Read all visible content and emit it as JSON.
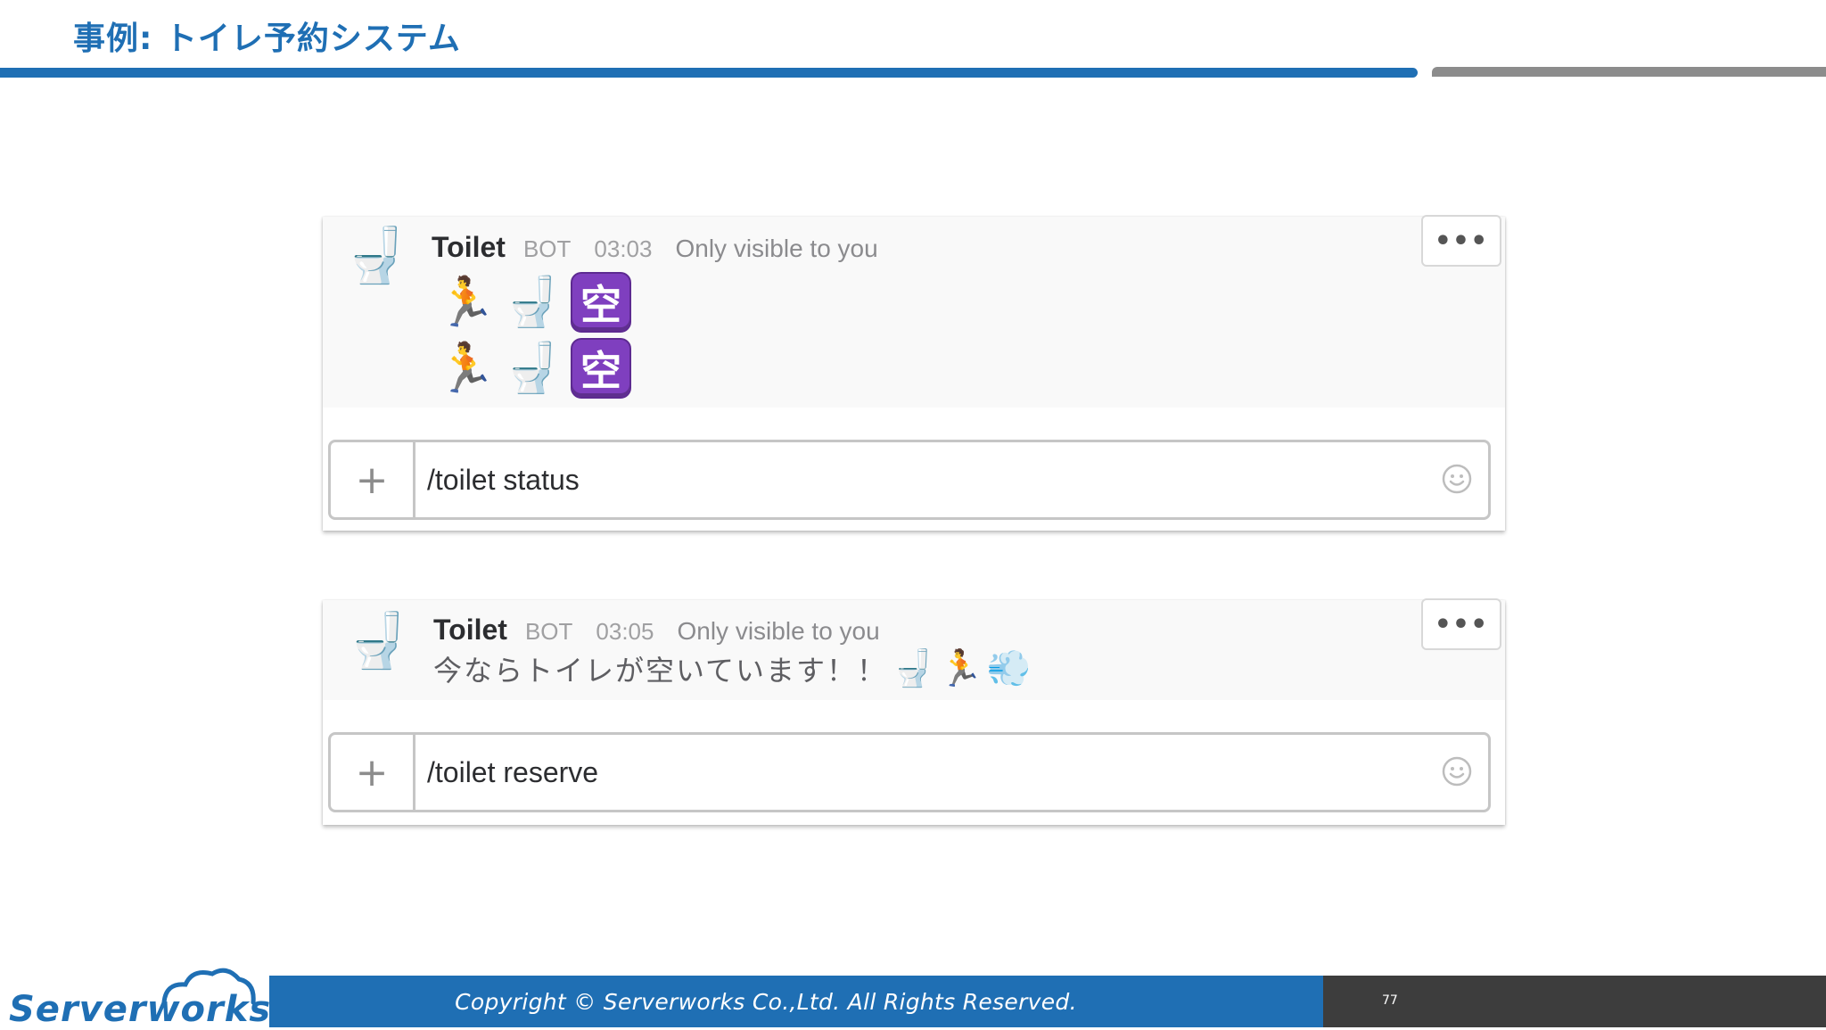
{
  "slide": {
    "title": "事例: トイレ予約システム"
  },
  "colors": {
    "brand_blue": "#1f6fb4",
    "bar_gray": "#8c8c8c",
    "footer_dark": "#3d3d3d",
    "kanji_badge_purple": "#7f3fbf"
  },
  "messages": [
    {
      "avatar_icon": "🚽",
      "bot_name": "Toilet",
      "bot_tag": "BOT",
      "time": "03:03",
      "visibility": "Only visible to you",
      "more_label": "•••",
      "emoji_rows": [
        {
          "runner": "🏃",
          "toilet": "🚽",
          "badge": "空"
        },
        {
          "runner": "🏃",
          "toilet": "🚽",
          "badge": "空"
        }
      ],
      "composer": {
        "plus_label": "+",
        "value": "/toilet status"
      }
    },
    {
      "avatar_icon": "🚽",
      "bot_name": "Toilet",
      "bot_tag": "BOT",
      "time": "03:05",
      "visibility": "Only visible to you",
      "more_label": "•••",
      "text": "今ならトイレが空いています！！",
      "trailing_emojis": [
        "🚽",
        "🏃",
        "💨"
      ],
      "composer": {
        "plus_label": "+",
        "value": "/toilet reserve"
      }
    }
  ],
  "footer": {
    "logo_text": "Serverworks",
    "copyright": "Copyright ©  Serverworks Co.,Ltd. All Rights Reserved.",
    "page_number": "77"
  }
}
